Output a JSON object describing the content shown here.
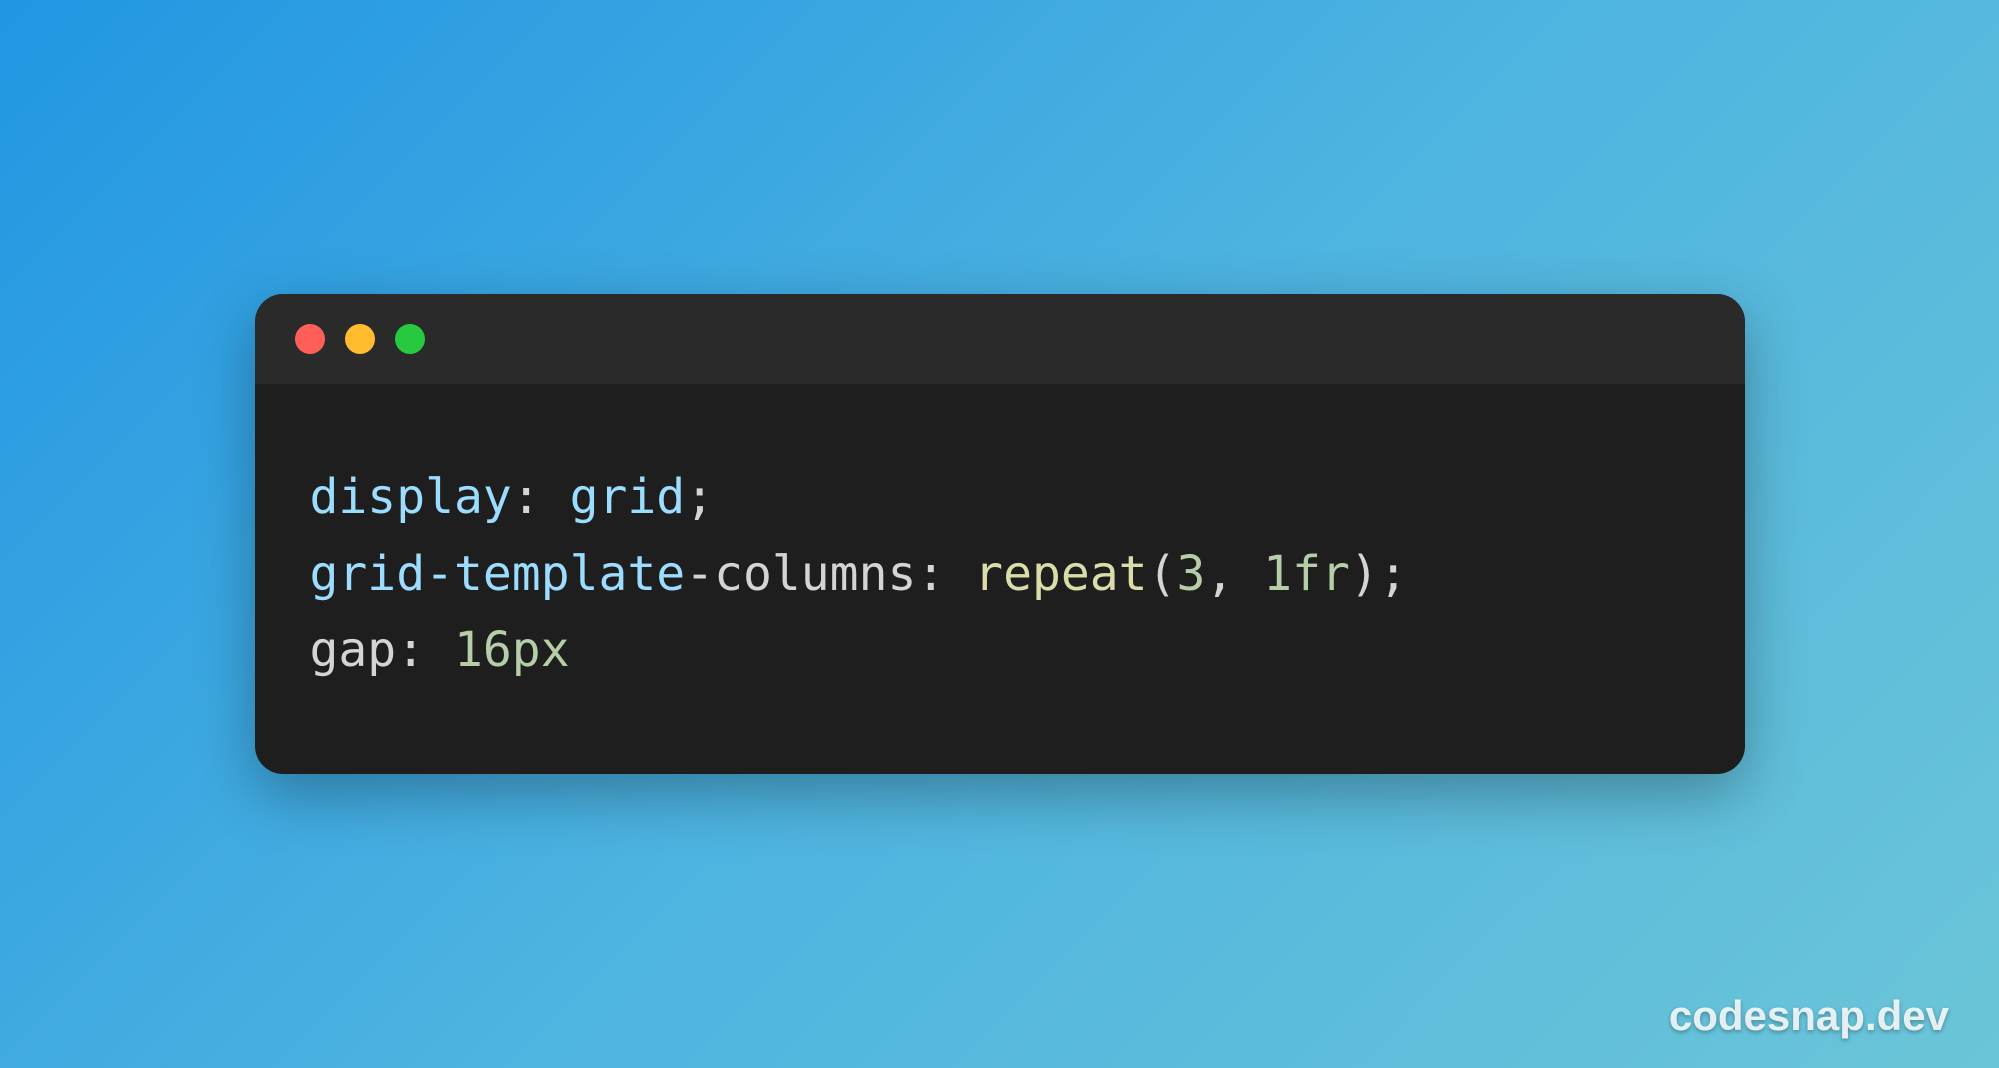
{
  "code": {
    "lines": [
      {
        "tokens": [
          {
            "class": "tok-prop-blue",
            "text": "display"
          },
          {
            "class": "tok-white",
            "text": ": "
          },
          {
            "class": "tok-value-blue",
            "text": "grid"
          },
          {
            "class": "tok-white",
            "text": ";"
          }
        ]
      },
      {
        "tokens": [
          {
            "class": "tok-prop-blue",
            "text": "grid-template"
          },
          {
            "class": "tok-white",
            "text": "-columns: "
          },
          {
            "class": "tok-yellow",
            "text": "repeat"
          },
          {
            "class": "tok-white",
            "text": "("
          },
          {
            "class": "tok-number",
            "text": "3"
          },
          {
            "class": "tok-white",
            "text": ", "
          },
          {
            "class": "tok-number",
            "text": "1"
          },
          {
            "class": "tok-unit",
            "text": "fr"
          },
          {
            "class": "tok-white",
            "text": ");"
          }
        ]
      },
      {
        "tokens": [
          {
            "class": "tok-white",
            "text": "gap: "
          },
          {
            "class": "tok-number",
            "text": "16"
          },
          {
            "class": "tok-unit",
            "text": "px"
          }
        ]
      }
    ]
  },
  "watermark": {
    "text": "codesnap.dev"
  }
}
